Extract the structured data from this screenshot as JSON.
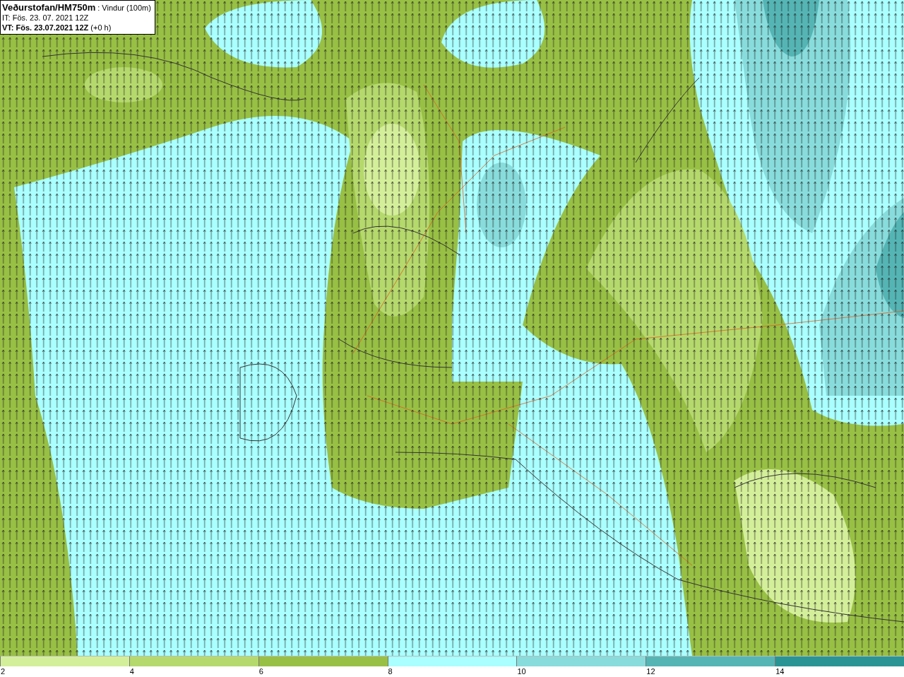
{
  "info_box": {
    "title": "**Veðurstofan/HM750m** : Vindur (100m)",
    "issue_time": "IT: Fös. 23. 07. 2021 12Z",
    "valid_time": "**VT: Fös. 23.07.2021 12Z** (+0 h)"
  },
  "legend": {
    "bins": [
      {
        "color": "#d4ef9a"
      },
      {
        "color": "#b5d96c"
      },
      {
        "color": "#98c044"
      },
      {
        "color": "#aaffff"
      },
      {
        "color": "#88dcdc"
      },
      {
        "color": "#55b5b5"
      },
      {
        "color": "#2a9494"
      }
    ],
    "labels": [
      "2",
      "4",
      "6",
      "8",
      "10",
      "12",
      "14"
    ]
  }
}
